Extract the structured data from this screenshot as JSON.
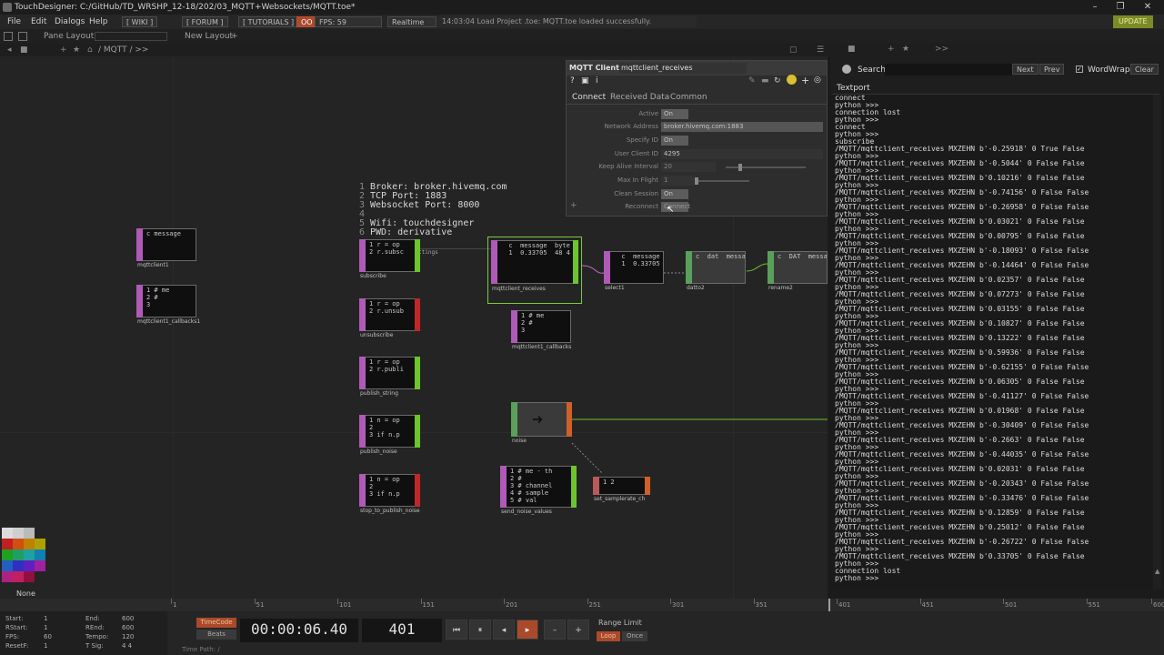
{
  "window": {
    "title": "TouchDesigner: C:/GitHub/TD_WRSHP_12-18/202/03_MQTT+Websockets/MQTT.toe*",
    "minimize": "–",
    "maximize": "❐",
    "close": "✕"
  },
  "menu": {
    "items": [
      "File",
      "Edit",
      "Dialogs",
      "Help"
    ],
    "wiki": "[ WIKI ]",
    "forum": "[ FORUM ]",
    "tutorials": "[ TUTORIALS ]",
    "oo": "OO",
    "fps": "FPS: 59",
    "realtime": "Realtime",
    "log": "14:03:04 Load Project .toe: MQTT.toe loaded successfully.",
    "update": "UPDATE"
  },
  "pane": {
    "layout_label": "Pane Layout",
    "new_layout": "New Layout",
    "plus": "+"
  },
  "netpath": {
    "path": "/ MQTT / >>"
  },
  "textport_path": ">>",
  "comment": {
    "lines": [
      "Broker: broker.hivemq.com",
      "TCP Port: 1883",
      "Websocket Port: 8000",
      "",
      "Wifi: touchdesigner",
      "PWD: derivative"
    ],
    "numbers": [
      "1",
      "2",
      "3",
      "4",
      "5",
      "6"
    ],
    "name": "MQTT_connection_settings"
  },
  "nodes": {
    "mqttclient1": {
      "text": "c message",
      "label": "mqttclient1"
    },
    "mqttclient1_callbacks": {
      "text": "1 # me\n2 #\n3",
      "label": "mqttclient1_callbacks1"
    },
    "subscribe": {
      "text": "1 r = op\n2 r.subsc",
      "label": "subscribe"
    },
    "unsubscribe": {
      "text": "1 r = op\n2 r.unsub",
      "label": "unsubscribe"
    },
    "publish_string": {
      "text": "1 r = op\n2 r.publi",
      "label": "publish_string"
    },
    "publish_noise": {
      "text": "1 n = op\n2\n3 if n.p",
      "label": "publish_noise"
    },
    "stop_to_publish_noise": {
      "text": "1 n = op\n2\n3 if n.p",
      "label": "stop_to_publish_noise"
    },
    "mqttclient_receives": {
      "text": "  c  message  byte\n  1  0.33705  48 4",
      "label": "mqttclient_receives"
    },
    "mqttclient_callbacks": {
      "text": "1 # me\n2 #\n3",
      "label": "mqttclient1_callbacks"
    },
    "select1": {
      "text": "  c  message\n  1  0.33705",
      "label": "select1"
    },
    "datto2": {
      "text": "c  dat  message",
      "label": "datto2"
    },
    "rename2": {
      "text": "c  DAT  message",
      "label": "rename2"
    },
    "noise": {
      "text": "",
      "label": "noise"
    },
    "send_noise_values": {
      "text": "1 # me - th\n2 #\n3 # channel\n4 # sample\n5 # val",
      "label": "send_noise_values"
    },
    "set_samplerate": {
      "text": "1 2",
      "label": "set_samplerate_ch"
    }
  },
  "param": {
    "title": "MQTT Client",
    "node_name": "mqttclient_receives",
    "tabs": [
      "Connect",
      "Received Data",
      "Common"
    ],
    "help": "?",
    "info": "i",
    "rows": [
      {
        "label": "Active",
        "value": "On"
      },
      {
        "label": "Network Address",
        "value": "broker.hivemq.com:1883"
      },
      {
        "label": "Specify ID",
        "value": "On"
      },
      {
        "label": "User Client ID",
        "value": "4295"
      },
      {
        "label": "Keep Alive Interval",
        "value": "20"
      },
      {
        "label": "Max In Flight",
        "value": "1"
      },
      {
        "label": "Clean Session",
        "value": "On"
      },
      {
        "label": "Reconnect",
        "value": "Connect"
      }
    ],
    "add": "+"
  },
  "textport": {
    "search_label": "Search",
    "next": "Next",
    "prev": "Prev",
    "wordwrap": "WordWrap",
    "clear": "Clear",
    "tab": "Textport",
    "lines": [
      "connect",
      "python >>>",
      "connection lost",
      "python >>>",
      "connect",
      "python >>>",
      "subscribe",
      "/MQTT/mqttclient_receives MXZEHN b'-0.25918' 0 True False",
      "python >>>",
      "/MQTT/mqttclient_receives MXZEHN b'-0.5044' 0 False False",
      "python >>>",
      "/MQTT/mqttclient_receives MXZEHN b'0.10216' 0 False False",
      "python >>>",
      "/MQTT/mqttclient_receives MXZEHN b'-0.74156' 0 False False",
      "python >>>",
      "/MQTT/mqttclient_receives MXZEHN b'-0.26958' 0 False False",
      "python >>>",
      "/MQTT/mqttclient_receives MXZEHN b'0.03021' 0 False False",
      "python >>>",
      "/MQTT/mqttclient_receives MXZEHN b'0.00795' 0 False False",
      "python >>>",
      "/MQTT/mqttclient_receives MXZEHN b'-0.18093' 0 False False",
      "python >>>",
      "/MQTT/mqttclient_receives MXZEHN b'-0.14464' 0 False False",
      "python >>>",
      "/MQTT/mqttclient_receives MXZEHN b'0.02357' 0 False False",
      "python >>>",
      "/MQTT/mqttclient_receives MXZEHN b'0.07273' 0 False False",
      "python >>>",
      "/MQTT/mqttclient_receives MXZEHN b'0.03155' 0 False False",
      "python >>>",
      "/MQTT/mqttclient_receives MXZEHN b'0.10827' 0 False False",
      "python >>>",
      "/MQTT/mqttclient_receives MXZEHN b'0.13222' 0 False False",
      "python >>>",
      "/MQTT/mqttclient_receives MXZEHN b'0.59936' 0 False False",
      "python >>>",
      "/MQTT/mqttclient_receives MXZEHN b'-0.62155' 0 False False",
      "python >>>",
      "/MQTT/mqttclient_receives MXZEHN b'0.06305' 0 False False",
      "python >>>",
      "/MQTT/mqttclient_receives MXZEHN b'-0.41127' 0 False False",
      "python >>>",
      "/MQTT/mqttclient_receives MXZEHN b'0.01968' 0 False False",
      "python >>>",
      "/MQTT/mqttclient_receives MXZEHN b'-0.30409' 0 False False",
      "python >>>",
      "/MQTT/mqttclient_receives MXZEHN b'-0.2663' 0 False False",
      "python >>>",
      "/MQTT/mqttclient_receives MXZEHN b'-0.44035' 0 False False",
      "python >>>",
      "/MQTT/mqttclient_receives MXZEHN b'0.02031' 0 False False",
      "python >>>",
      "/MQTT/mqttclient_receives MXZEHN b'-0.20343' 0 False False",
      "python >>>",
      "/MQTT/mqttclient_receives MXZEHN b'-0.33476' 0 False False",
      "python >>>",
      "/MQTT/mqttclient_receives MXZEHN b'0.12859' 0 False False",
      "python >>>",
      "/MQTT/mqttclient_receives MXZEHN b'0.25012' 0 False False",
      "python >>>",
      "/MQTT/mqttclient_receives MXZEHN b'-0.26722' 0 False False",
      "python >>>",
      "/MQTT/mqttclient_receives MXZEHN b'0.33705' 0 False False",
      "python >>>",
      "connection lost",
      "python >>>"
    ]
  },
  "timeline": {
    "ticks": [
      "1",
      "51",
      "101",
      "151",
      "201",
      "251",
      "301",
      "351",
      "401",
      "451",
      "501",
      "551",
      "600"
    ],
    "current_label": "401"
  },
  "bottom": {
    "swatch_label": "None",
    "info": {
      "start_lbl": "Start:",
      "start": "1",
      "end_lbl": "End:",
      "end": "600",
      "rstart_lbl": "RStart:",
      "rstart": "1",
      "rend_lbl": "REnd:",
      "rend": "600",
      "fps_lbl": "FPS:",
      "fps": "60",
      "tempo_lbl": "Tempo:",
      "tempo": "120",
      "resetf_lbl": "ResetF:",
      "resetf": "1",
      "tsig_lbl": "T Sig:",
      "tsig": "4    4"
    },
    "timecode": "TimeCode",
    "beats": "Beats",
    "time": "00:00:06.40",
    "frame": "401",
    "range_limit": "Range Limit",
    "loop": "Loop",
    "once": "Once",
    "timepath": "Time Path: /"
  },
  "colors": {
    "accent": "#aa4a2a",
    "dat": "#b05ab8",
    "chop": "#5aa05a",
    "viewer_flag": "#6cc52e",
    "bypass_flag": "#c02828"
  }
}
